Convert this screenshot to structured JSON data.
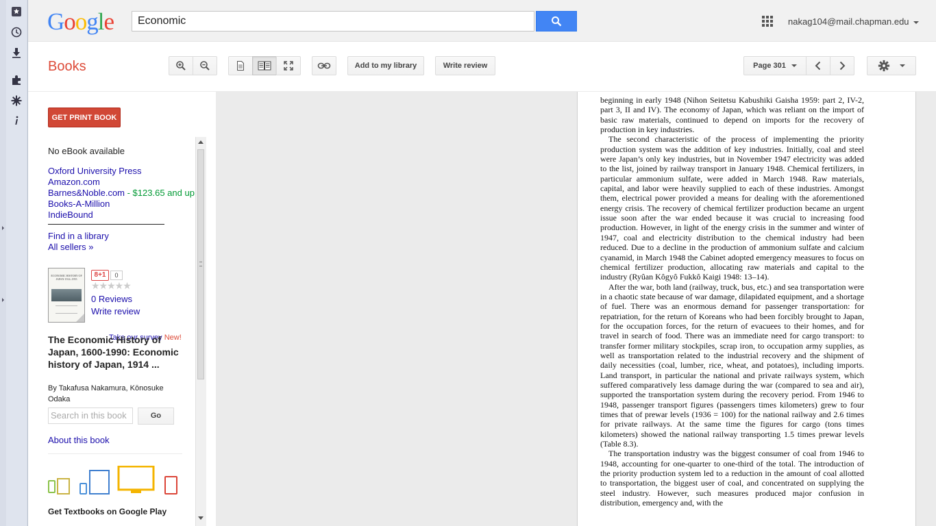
{
  "browser": {
    "rail_icons": [
      "bookmark-icon",
      "history-icon",
      "download-icon",
      "extension-icon",
      "settings-icon",
      "info-icon"
    ]
  },
  "header": {
    "logo": "Google",
    "logo_colors": [
      "#4285f4",
      "#ea4335",
      "#fbbc05",
      "#4285f4",
      "#34a853",
      "#ea4335"
    ],
    "search_value": "Economic",
    "account": "nakag104@mail.chapman.edu"
  },
  "toolbar": {
    "title": "Books",
    "add_library": "Add to my library",
    "write_review": "Write review",
    "page_label": "Page 301"
  },
  "sidebar": {
    "get_print": "GET PRINT BOOK",
    "no_ebook": "No eBook available",
    "sellers": [
      {
        "name": "Oxford University Press",
        "price": ""
      },
      {
        "name": "Amazon.com",
        "price": ""
      },
      {
        "name": "Barnes&Noble.com",
        "price": " - $123.65 and up"
      },
      {
        "name": "Books-A-Million",
        "price": ""
      },
      {
        "name": "IndieBound",
        "price": ""
      }
    ],
    "find_library": "Find in a library",
    "all_sellers": "All sellers »",
    "gplus": "8+1",
    "gplus_count": "0",
    "reviews": "0 Reviews",
    "write_review": "Write review",
    "survey": "Take our survey",
    "survey_new": "New!",
    "book_title": "The Economic History of Japan, 1600-1990: Economic history of Japan, 1914 ...",
    "by": "By Takafusa Nakamura, Kōnosuke Odaka",
    "cover_title": "ECONOMIC HISTORY OF JAPAN 1914–1955",
    "search_placeholder": "Search in this book",
    "go": "Go",
    "about": "About this book",
    "textbooks": "Get Textbooks on Google Play"
  },
  "page": {
    "paragraphs": [
      {
        "indent": false,
        "text": "beginning in early 1948 (Nihon Seitetsu Kabushiki Gaisha 1959: part 2, IV-2, part 3, II and IV). The economy of Japan, which was reliant on the import of basic raw materials, continued to depend on imports for the recovery of production in key industries."
      },
      {
        "indent": true,
        "text": "The second characteristic of the process of implementing the priority production system was the addition of key industries. Initially, coal and steel were Japan’s only key industries, but in November 1947 electricity was added to the list, joined by railway transport in January 1948. Chemical fertilizers, in particular ammonium sulfate, were added in March 1948. Raw materials, capital, and labor were heavily supplied to each of these industries. Amongst them, electrical power provided a means for dealing with the aforementioned energy crisis. The recovery of chemical fertilizer production became an urgent issue soon after the war ended because it was crucial to increasing food production. However, in light of the energy crisis in the summer and winter of 1947, coal and electricity distribution to the chemical industry had been reduced. Due to a decline in the production of ammonium sulfate and calcium cyanamid, in March 1948 the Cabinet adopted emergency measures to focus on chemical fertilizer production, allocating raw materials and capital to the industry (Ryûan Kôgyô Fukkô Kaigi 1948: 13–14)."
      },
      {
        "indent": true,
        "text": "After the war, both land (railway, truck, bus, etc.) and sea transportation were in a chaotic state because of war damage, dilapidated equipment, and a shortage of fuel. There was an enormous demand for passenger transportation: for repatriation, for the return of Koreans who had been forcibly brought to Japan, for the occupation forces, for the return of evacuees to their homes, and for travel in search of food. There was an immediate need for cargo transport: to transfer former military stockpiles, scrap iron, to occupation army supplies, as well as transportation related to the industrial recovery and the shipment of daily necessities (coal, lumber, rice, wheat, and potatoes), including imports. Land transport, in particular the national and private railways system, which suffered comparatively less damage during the war (compared to sea and air), supported the transportation system during the recovery period. From 1946 to 1948, passenger transport figures (passengers times kilometers) grew to four times that of prewar levels (1936 = 100) for the national railway and 2.6 times for private railways. At the same time the figures for cargo (tons times kilometers) showed the national railway transporting 1.5 times prewar levels (Table 8.3)."
      },
      {
        "indent": true,
        "text": "The transportation industry was the biggest consumer of coal from 1946 to 1948, accounting for one-quarter to one-third of the total. The introduction of the priority production system led to a reduction in the amount of coal allotted to transportation, the biggest user of coal, and concentrated on supplying the steel industry. However, such measures produced major confusion in distribution, emergency and, with the"
      }
    ]
  }
}
